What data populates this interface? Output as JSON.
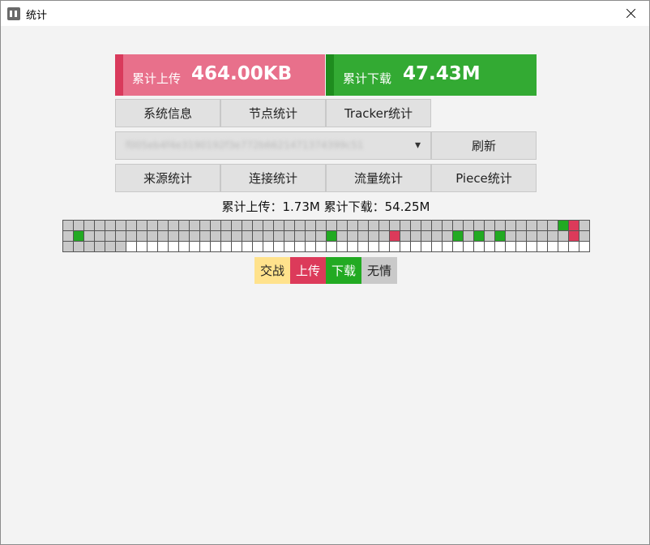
{
  "window": {
    "title": "统计",
    "close_icon": "close-icon",
    "app_icon": "app-icon"
  },
  "colors": {
    "upload": "#e8708b",
    "upload_accent": "#d93a5c",
    "download": "#33aa33",
    "download_accent": "#1e8c1e",
    "exchange": "#ffe28c",
    "upload_cell": "#dc3a5a",
    "download_cell": "#22aa22",
    "none": "#c9c9c9",
    "empty": "#ffffff"
  },
  "stats": {
    "upload_label": "累计上传",
    "upload_value": "464.00KB",
    "download_label": "累计下载",
    "download_value": "47.43M"
  },
  "tabs": [
    {
      "label": "系统信息"
    },
    {
      "label": "节点统计"
    },
    {
      "label": "Tracker统计"
    }
  ],
  "torrent_select": {
    "value": "f005eb4f4e3190192f3e772b6621471374399c51",
    "icon": "chevron-down-icon"
  },
  "refresh_label": "刷新",
  "sub_tabs": [
    {
      "label": "来源统计"
    },
    {
      "label": "连接统计"
    },
    {
      "label": "流量统计"
    },
    {
      "label": "Piece统计"
    }
  ],
  "summary": "累计上传：1.73M 累计下载：54.25M",
  "piece_grid": {
    "rows": [
      "GGGGGGGGGGGGGGGGGGGGGGGGGGGGGGGGGGGGGGGGGGGGGGGDUGGDGGGG",
      "GDGGGGGGGGGGGGGGGGGGGGGGGDGGGGGUGGGGGDGDGDGGGGGGUGGUGG",
      "GGGGGGWWWWWWWWWWWWWWWWWWWWWWWWWWWWWWWWWWWWWWWWWWWWWWWW"
    ]
  },
  "legend": [
    {
      "label": "交战",
      "color": "#ffe28c"
    },
    {
      "label": "上传",
      "color": "#dc3a5a"
    },
    {
      "label": "下载",
      "color": "#22aa22"
    },
    {
      "label": "无情",
      "color": "#c9c9c9"
    }
  ]
}
